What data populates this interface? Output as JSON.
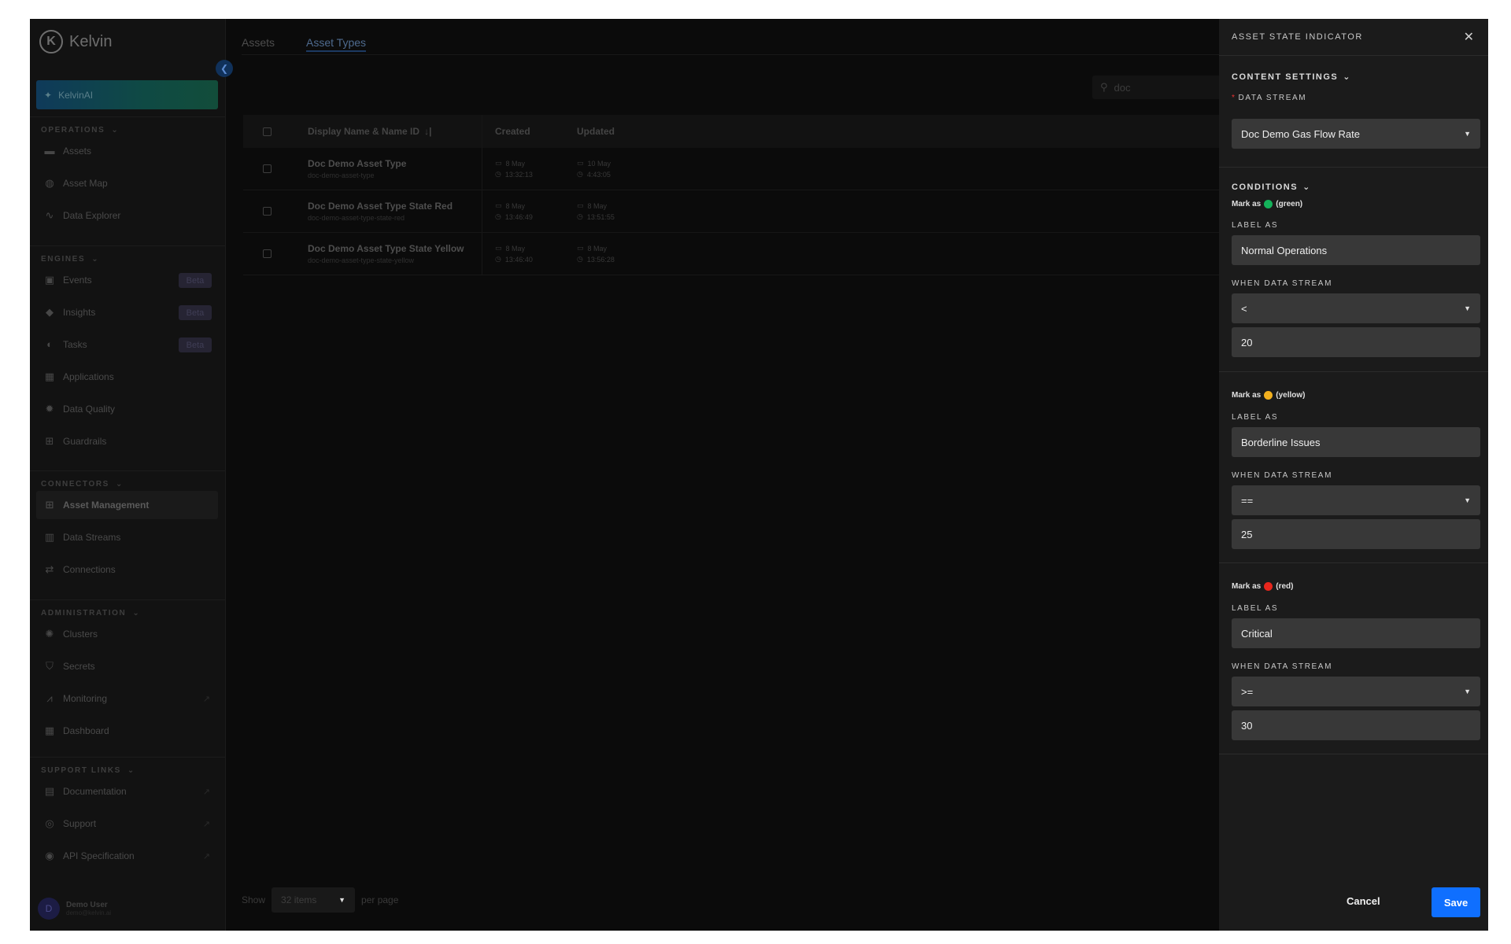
{
  "brand": {
    "name": "Kelvin"
  },
  "sidebar": {
    "kelvinai_label": "KelvinAI",
    "sections": [
      {
        "title": "OPERATIONS",
        "items": [
          {
            "label": "Assets",
            "icon": "assets-icon"
          },
          {
            "label": "Asset Map",
            "icon": "globe-icon"
          },
          {
            "label": "Data Explorer",
            "icon": "pulse-icon"
          }
        ]
      },
      {
        "title": "ENGINES",
        "items": [
          {
            "label": "Events",
            "icon": "events-icon",
            "badge": "Beta"
          },
          {
            "label": "Insights",
            "icon": "tag-icon",
            "badge": "Beta"
          },
          {
            "label": "Tasks",
            "icon": "tasks-icon",
            "badge": "Beta"
          },
          {
            "label": "Applications",
            "icon": "apps-icon"
          },
          {
            "label": "Data Quality",
            "icon": "gear-icon"
          },
          {
            "label": "Guardrails",
            "icon": "guardrail-icon"
          }
        ]
      },
      {
        "title": "CONNECTORS",
        "items": [
          {
            "label": "Asset Management",
            "icon": "asset-management-icon"
          },
          {
            "label": "Data Streams",
            "icon": "chart-icon"
          },
          {
            "label": "Connections",
            "icon": "connections-icon"
          }
        ]
      },
      {
        "title": "ADMINISTRATION",
        "items": [
          {
            "label": "Clusters",
            "icon": "clusters-icon"
          },
          {
            "label": "Secrets",
            "icon": "shield-icon"
          },
          {
            "label": "Monitoring",
            "icon": "monitoring-icon"
          },
          {
            "label": "Dashboard",
            "icon": "dashboard-icon"
          }
        ]
      },
      {
        "title": "SUPPORT LINKS",
        "items": [
          {
            "label": "Documentation",
            "icon": "document-icon"
          },
          {
            "label": "Support",
            "icon": "support-icon"
          },
          {
            "label": "API Specification",
            "icon": "api-icon"
          }
        ]
      }
    ],
    "user": {
      "initial": "D",
      "name": "Demo User",
      "email": "demo@kelvin.ai"
    }
  },
  "main": {
    "tabs": [
      {
        "label": "Assets"
      },
      {
        "label": "Asset Types"
      }
    ],
    "search_value": "doc",
    "columns": {
      "name": "Display Name & Name ID",
      "created": "Created",
      "updated": "Updated"
    },
    "rows": [
      {
        "title": "Doc Demo Asset Type",
        "sub": "doc-demo-asset-type",
        "created_date": "8 May",
        "created_time": "13:32:13",
        "updated_date": "10 May",
        "updated_time": "4:43:05"
      },
      {
        "title": "Doc Demo Asset Type State Red",
        "sub": "doc-demo-asset-type-state-red",
        "created_date": "8 May",
        "created_time": "13:46:49",
        "updated_date": "8 May",
        "updated_time": "13:51:55"
      },
      {
        "title": "Doc Demo Asset Type State Yellow",
        "sub": "doc-demo-asset-type-state-yellow",
        "created_date": "8 May",
        "created_time": "13:46:40",
        "updated_date": "8 May",
        "updated_time": "13:56:28"
      }
    ],
    "pager": {
      "show": "Show",
      "items": "32 items",
      "per_page": "per page"
    }
  },
  "panel": {
    "title": "ASSET STATE INDICATOR",
    "content_settings": "CONTENT SETTINGS",
    "data_stream_label": "DATA STREAM",
    "data_stream_value": "Doc Demo Gas Flow Rate",
    "conditions_title": "CONDITIONS",
    "conditions": [
      {
        "mark_prefix": "Mark as",
        "color_name": "(green)",
        "color": "#14b25a",
        "label_as": "LABEL AS",
        "label_value": "Normal Operations",
        "when": "WHEN DATA STREAM",
        "operator": "<",
        "threshold": "20"
      },
      {
        "mark_prefix": "Mark as",
        "color_name": "(yellow)",
        "color": "#f2b01e",
        "label_as": "LABEL AS",
        "label_value": "Borderline Issues",
        "when": "WHEN DATA STREAM",
        "operator": "==",
        "threshold": "25"
      },
      {
        "mark_prefix": "Mark as",
        "color_name": "(red)",
        "color": "#e8261c",
        "label_as": "LABEL AS",
        "label_value": "Critical",
        "when": "WHEN DATA STREAM",
        "operator": ">=",
        "threshold": "30"
      }
    ],
    "cancel_label": "Cancel",
    "save_label": "Save"
  }
}
